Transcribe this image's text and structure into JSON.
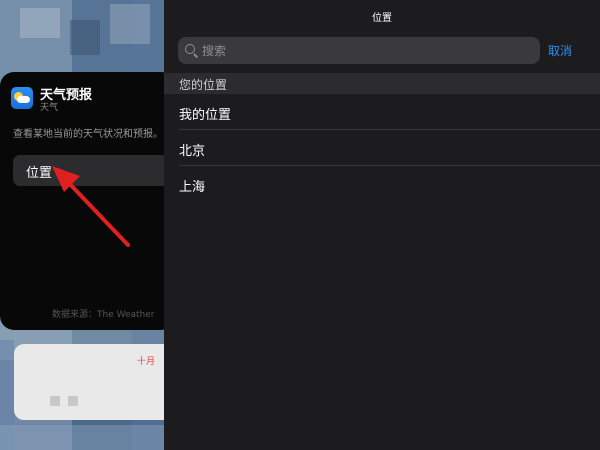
{
  "widget": {
    "title": "天气预报",
    "subtitle": "天气",
    "description": "查看某地当前的天气状况和预报。",
    "location_button": "位置",
    "source": "数据来源：The Weather"
  },
  "card2": {
    "month": "十月"
  },
  "panel": {
    "title": "位置",
    "search_placeholder": "搜索",
    "cancel_label": "取消",
    "section_header": "您的位置",
    "items": [
      {
        "label": "我的位置"
      },
      {
        "label": "北京"
      },
      {
        "label": "上海"
      }
    ]
  },
  "colors": {
    "accent": "#2e8ef0",
    "arrow": "#e02020",
    "panel_bg": "#1c1c1e"
  }
}
